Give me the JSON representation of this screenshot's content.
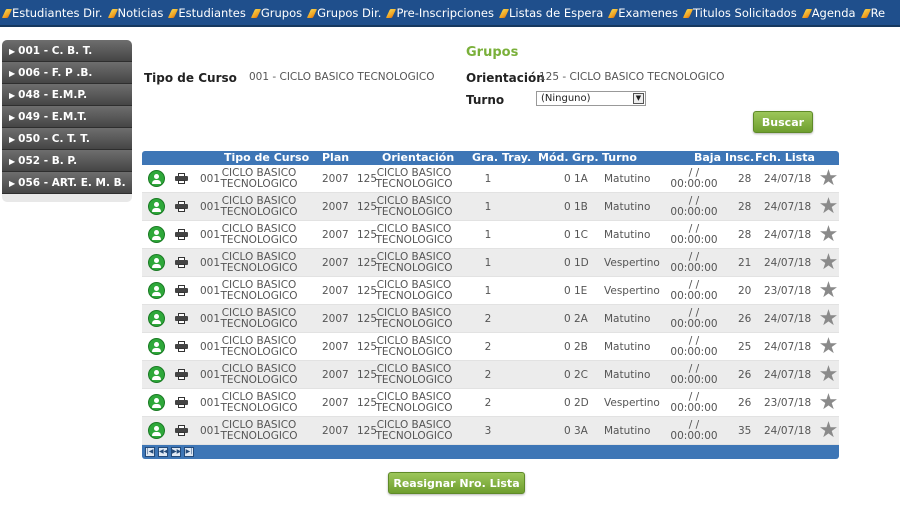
{
  "topnav": [
    "Estudiantes Dir.",
    "Noticias",
    "Estudiantes",
    "Grupos",
    "Grupos Dir.",
    "Pre-Inscripciones",
    "Listas de Espera",
    "Examenes",
    "Titulos Solicitados",
    "Agenda",
    "Re"
  ],
  "sidebar": [
    "001 - C. B. T.",
    "006 - F. P .B.",
    "048 - E.M.P.",
    "049 - E.M.T.",
    "050 - C. T. T.",
    "052 - B. P.",
    "056 - ART. E. M. B."
  ],
  "header": {
    "section_title": "Grupos",
    "tipo_label": "Tipo de Curso",
    "tipo_value": "001 - CICLO BASICO TECNOLOGICO",
    "orientacion_label": "Orientación",
    "orientacion_value": "125 - CICLO BASICO TECNOLOGICO",
    "turno_label": "Turno",
    "turno_value": "(Ninguno)",
    "buscar_label": "Buscar"
  },
  "grid": {
    "columns": [
      "Tipo de Curso",
      "Plan",
      "Orientación",
      "Gra.",
      "Tray.",
      "Mód.",
      "Grp.",
      "Turno",
      "Baja",
      "Insc.",
      "Fch. Lista"
    ],
    "rows": [
      {
        "code": "001",
        "tipo1": "CICLO BASICO",
        "tipo2": "TECNOLOGICO",
        "plan": "2007",
        "ori_code": "125",
        "ori1": "CICLO BASICO",
        "ori2": "TECNOLOGICO",
        "gra": "1",
        "mod": "0",
        "grp": "1A",
        "turno": "Matutino",
        "baja1": "/ /",
        "baja2": "00:00:00",
        "insc": "28",
        "fecha": "24/07/18"
      },
      {
        "code": "001",
        "tipo1": "CICLO BASICO",
        "tipo2": "TECNOLOGICO",
        "plan": "2007",
        "ori_code": "125",
        "ori1": "CICLO BASICO",
        "ori2": "TECNOLOGICO",
        "gra": "1",
        "mod": "0",
        "grp": "1B",
        "turno": "Matutino",
        "baja1": "/ /",
        "baja2": "00:00:00",
        "insc": "28",
        "fecha": "24/07/18"
      },
      {
        "code": "001",
        "tipo1": "CICLO BASICO",
        "tipo2": "TECNOLOGICO",
        "plan": "2007",
        "ori_code": "125",
        "ori1": "CICLO BASICO",
        "ori2": "TECNOLOGICO",
        "gra": "1",
        "mod": "0",
        "grp": "1C",
        "turno": "Matutino",
        "baja1": "/ /",
        "baja2": "00:00:00",
        "insc": "28",
        "fecha": "24/07/18"
      },
      {
        "code": "001",
        "tipo1": "CICLO BASICO",
        "tipo2": "TECNOLOGICO",
        "plan": "2007",
        "ori_code": "125",
        "ori1": "CICLO BASICO",
        "ori2": "TECNOLOGICO",
        "gra": "1",
        "mod": "0",
        "grp": "1D",
        "turno": "Vespertino",
        "baja1": "/ /",
        "baja2": "00:00:00",
        "insc": "21",
        "fecha": "24/07/18"
      },
      {
        "code": "001",
        "tipo1": "CICLO BASICO",
        "tipo2": "TECNOLOGICO",
        "plan": "2007",
        "ori_code": "125",
        "ori1": "CICLO BASICO",
        "ori2": "TECNOLOGICO",
        "gra": "1",
        "mod": "0",
        "grp": "1E",
        "turno": "Vespertino",
        "baja1": "/ /",
        "baja2": "00:00:00",
        "insc": "20",
        "fecha": "23/07/18"
      },
      {
        "code": "001",
        "tipo1": "CICLO BASICO",
        "tipo2": "TECNOLOGICO",
        "plan": "2007",
        "ori_code": "125",
        "ori1": "CICLO BASICO",
        "ori2": "TECNOLOGICO",
        "gra": "2",
        "mod": "0",
        "grp": "2A",
        "turno": "Matutino",
        "baja1": "/ /",
        "baja2": "00:00:00",
        "insc": "26",
        "fecha": "24/07/18"
      },
      {
        "code": "001",
        "tipo1": "CICLO BASICO",
        "tipo2": "TECNOLOGICO",
        "plan": "2007",
        "ori_code": "125",
        "ori1": "CICLO BASICO",
        "ori2": "TECNOLOGICO",
        "gra": "2",
        "mod": "0",
        "grp": "2B",
        "turno": "Matutino",
        "baja1": "/ /",
        "baja2": "00:00:00",
        "insc": "25",
        "fecha": "24/07/18"
      },
      {
        "code": "001",
        "tipo1": "CICLO BASICO",
        "tipo2": "TECNOLOGICO",
        "plan": "2007",
        "ori_code": "125",
        "ori1": "CICLO BASICO",
        "ori2": "TECNOLOGICO",
        "gra": "2",
        "mod": "0",
        "grp": "2C",
        "turno": "Matutino",
        "baja1": "/ /",
        "baja2": "00:00:00",
        "insc": "26",
        "fecha": "24/07/18"
      },
      {
        "code": "001",
        "tipo1": "CICLO BASICO",
        "tipo2": "TECNOLOGICO",
        "plan": "2007",
        "ori_code": "125",
        "ori1": "CICLO BASICO",
        "ori2": "TECNOLOGICO",
        "gra": "2",
        "mod": "0",
        "grp": "2D",
        "turno": "Vespertino",
        "baja1": "/ /",
        "baja2": "00:00:00",
        "insc": "26",
        "fecha": "23/07/18"
      },
      {
        "code": "001",
        "tipo1": "CICLO BASICO",
        "tipo2": "TECNOLOGICO",
        "plan": "2007",
        "ori_code": "125",
        "ori1": "CICLO BASICO",
        "ori2": "TECNOLOGICO",
        "gra": "3",
        "mod": "0",
        "grp": "3A",
        "turno": "Matutino",
        "baja1": "/ /",
        "baja2": "00:00:00",
        "insc": "35",
        "fecha": "24/07/18"
      }
    ]
  },
  "pager": [
    "first",
    "prev",
    "next",
    "last"
  ],
  "footer": {
    "reasignar_label": "Reasignar Nro. Lista"
  },
  "colors": {
    "nav": "#1f4f8c",
    "grid_header": "#3e76b6",
    "accent_green": "#7ab03a",
    "user_icon": "#2ea83a"
  }
}
